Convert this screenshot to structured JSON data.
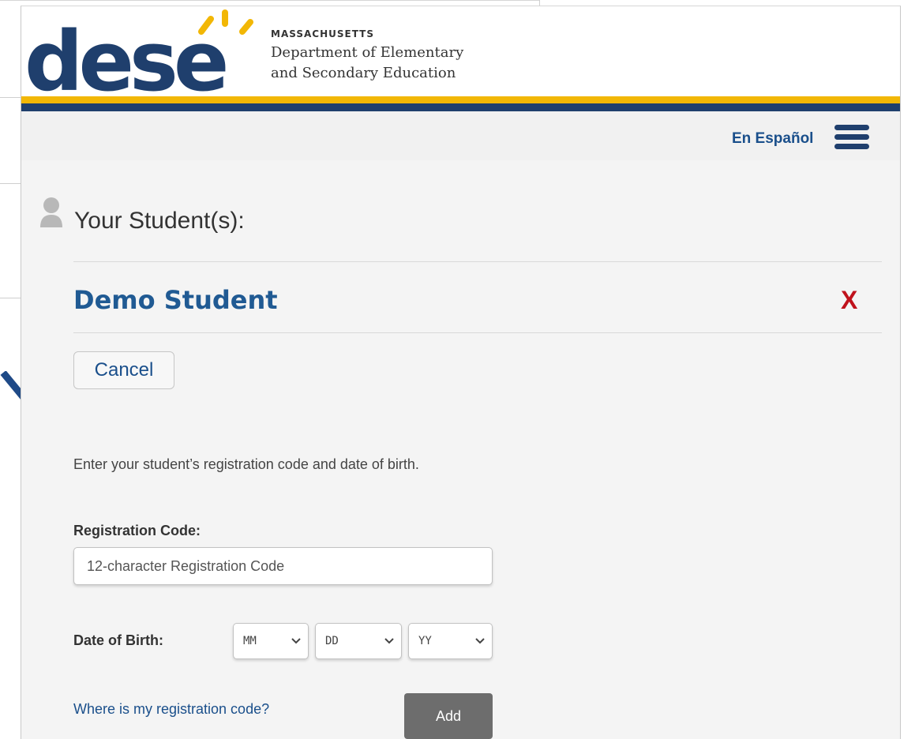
{
  "header": {
    "logo_text": "dese",
    "org_line1": "MASSACHUSETTS",
    "org_line2": "Department of Elementary",
    "org_line3": "and Secondary Education",
    "brand_blue": "#1f3f6d",
    "brand_yellow": "#f2b705"
  },
  "nav": {
    "language_link": "En Español",
    "menu_icon": "hamburger-menu-icon"
  },
  "students": {
    "section_title": "Your Student(s):",
    "section_icon": "user-icon",
    "items": [
      {
        "name": "Demo Student",
        "remove_label": "X"
      }
    ]
  },
  "form": {
    "cancel_label": "Cancel",
    "instructions": "Enter your student’s registration code and date of birth.",
    "registration_label": "Registration Code:",
    "registration_placeholder": "12-character Registration Code",
    "dob_label": "Date of Birth:",
    "month_selected": "MM",
    "day_selected": "DD",
    "year_selected": "YY",
    "help_link": "Where is my registration code?",
    "add_label": "Add"
  },
  "annotation": {
    "arrow_color": "#1f4a87"
  }
}
